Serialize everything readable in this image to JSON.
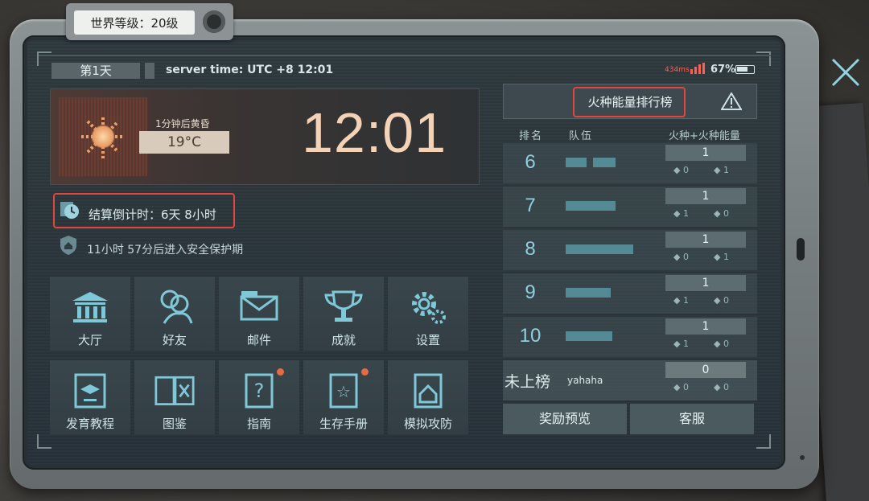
{
  "world_level": "世界等级：20级",
  "topbar": {
    "day": "第1天",
    "server_time": "server time: UTC +8 12:01",
    "ping": "434ms",
    "battery": "67%",
    "battery_fraction": 0.67
  },
  "weather": {
    "subtitle": "1分钟后黄昏",
    "temperature": "19°C",
    "clock": "12:01"
  },
  "countdown": "结算倒计时：6天 8小时",
  "protection": "11小时 57分后进入安全保护期",
  "menu": [
    {
      "label": "大厅",
      "icon": "hall-icon",
      "notify": false
    },
    {
      "label": "好友",
      "icon": "friends-icon",
      "notify": false
    },
    {
      "label": "邮件",
      "icon": "mail-icon",
      "notify": false
    },
    {
      "label": "成就",
      "icon": "trophy-icon",
      "notify": false
    },
    {
      "label": "设置",
      "icon": "gear-icon",
      "notify": false
    },
    {
      "label": "发育教程",
      "icon": "tutorial-icon",
      "notify": false
    },
    {
      "label": "图鉴",
      "icon": "book-icon",
      "notify": false
    },
    {
      "label": "指南",
      "icon": "guide-icon",
      "notify": true
    },
    {
      "label": "生存手册",
      "icon": "manual-icon",
      "notify": true
    },
    {
      "label": "模拟攻防",
      "icon": "simulation-icon",
      "notify": false
    }
  ],
  "leaderboard": {
    "title": "火种能量排行榜",
    "col_rank": "排名",
    "col_team": "队伍",
    "col_score": "火种+火种能量",
    "rows": [
      {
        "rank": "6",
        "score": "1",
        "a": "0",
        "b": "1"
      },
      {
        "rank": "7",
        "score": "1",
        "a": "1",
        "b": "0"
      },
      {
        "rank": "8",
        "score": "1",
        "a": "0",
        "b": "1"
      },
      {
        "rank": "9",
        "score": "1",
        "a": "1",
        "b": "0"
      },
      {
        "rank": "10",
        "score": "1",
        "a": "1",
        "b": "0"
      }
    ],
    "unranked": {
      "label": "未上榜",
      "name": "yahaha",
      "score": "0",
      "a": "0",
      "b": "0"
    },
    "reward_button": "奖励预览",
    "service_button": "客服"
  }
}
